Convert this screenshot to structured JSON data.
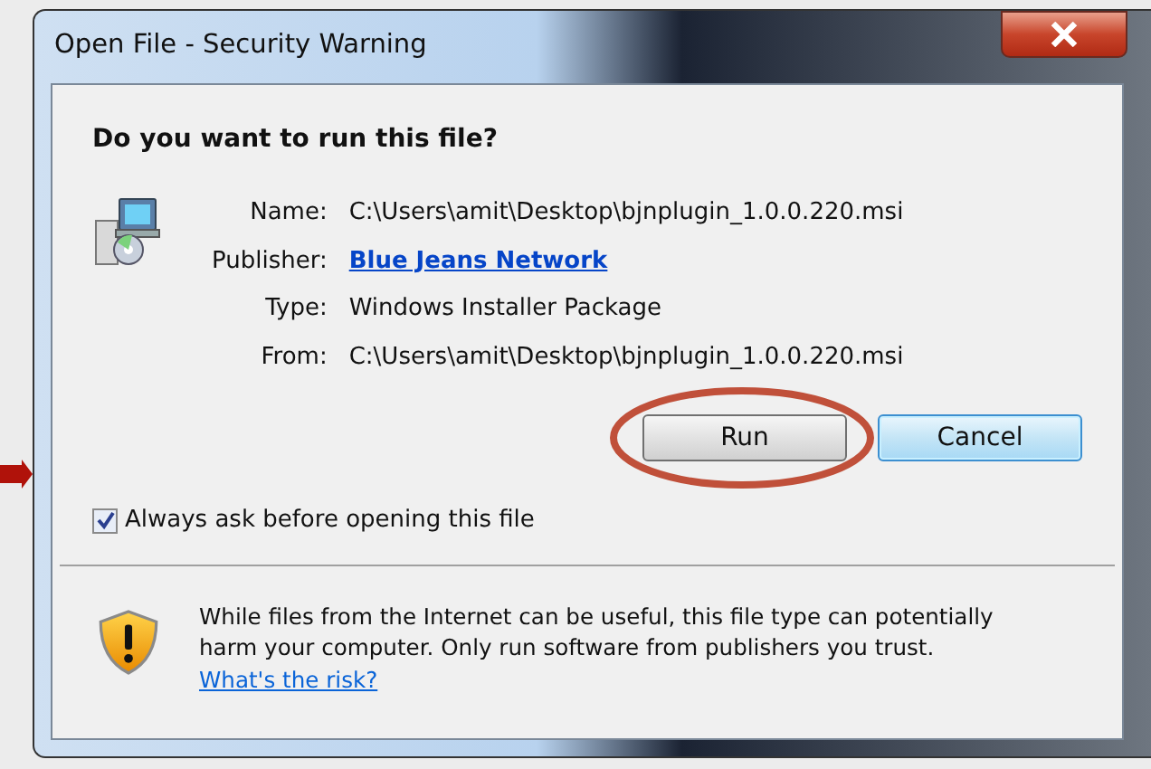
{
  "window": {
    "title": "Open File - Security Warning"
  },
  "question": "Do you want to run this file?",
  "fields": [
    {
      "label": "Name:",
      "value": "C:\\Users\\amit\\Desktop\\bjnplugin_1.0.0.220.msi",
      "kind": "text"
    },
    {
      "label": "Publisher:",
      "value": "Blue Jeans Network",
      "kind": "link"
    },
    {
      "label": "Type:",
      "value": "Windows Installer Package",
      "kind": "text"
    },
    {
      "label": "From:",
      "value": "C:\\Users\\amit\\Desktop\\bjnplugin_1.0.0.220.msi",
      "kind": "text"
    }
  ],
  "buttons": [
    {
      "label": "Run",
      "default": false,
      "annotated": true
    },
    {
      "label": "Cancel",
      "default": true,
      "annotated": false
    }
  ],
  "checkbox": {
    "label": "Always ask before opening this file",
    "checked": true
  },
  "warning": {
    "text": "While files from the Internet can be useful, this file type can potentially harm your computer. Only run software from publishers you trust.",
    "link": "What's the risk?"
  }
}
